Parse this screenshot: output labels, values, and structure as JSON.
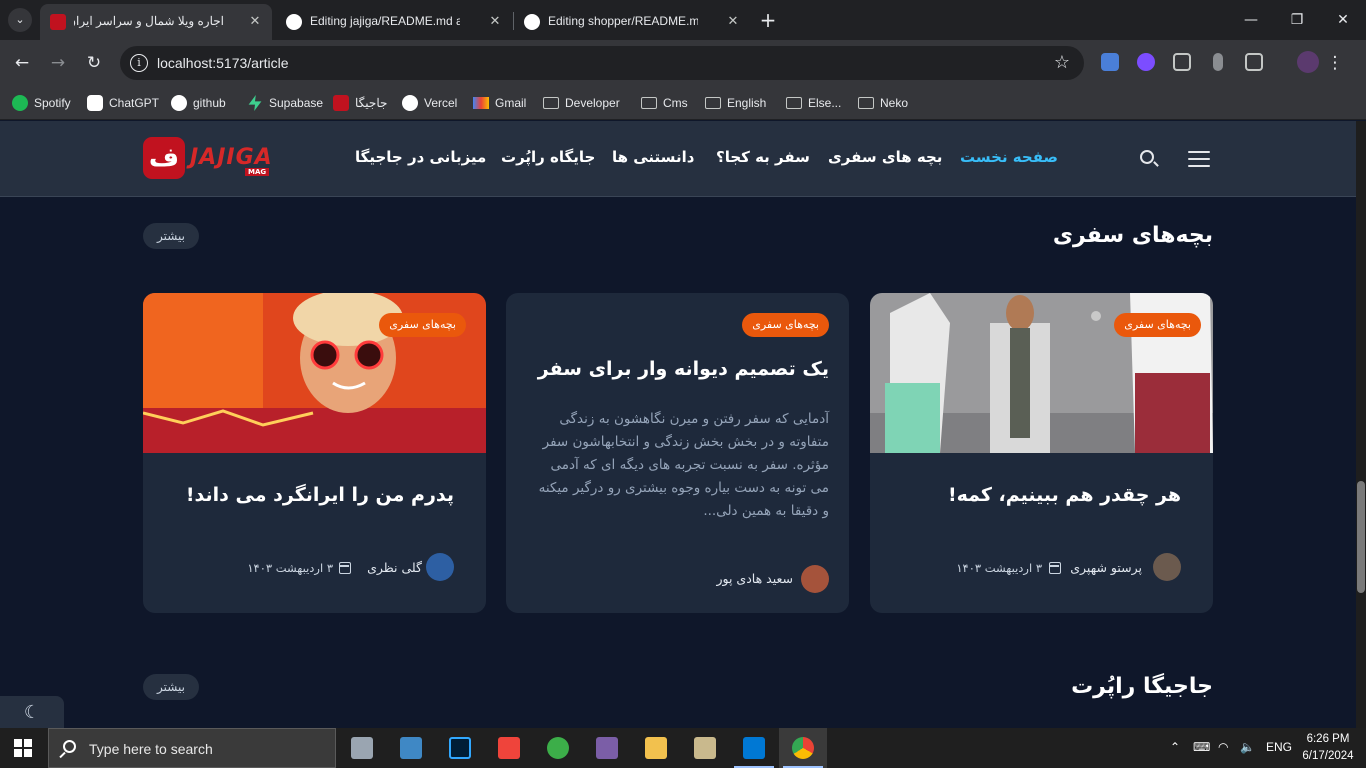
{
  "browser": {
    "tabs": [
      {
        "title": "اجاره ویلا شمال و سراسر ایران زیبا",
        "active": true
      },
      {
        "title": "Editing jajiga/README.md at m",
        "active": false
      },
      {
        "title": "Editing shopper/README.md at",
        "active": false
      }
    ],
    "url": "localhost:5173/article",
    "bookmarks": [
      "Spotify",
      "ChatGPT",
      "github",
      "Supabase",
      "جاجیگا",
      "Vercel",
      "Gmail",
      "Developer",
      "Cms",
      "English",
      "Else...",
      "Neko"
    ]
  },
  "site": {
    "logo_text": "JAJIGA",
    "logo_sub": "MAG",
    "nav": [
      "صفحه نخست",
      "بچه های سفری",
      "سفر به کجا؟",
      "دانستنی ها",
      "جایگاه راپُرت",
      "میزبانی در جاجیگا"
    ],
    "active_nav": "صفحه نخست"
  },
  "sections": [
    {
      "title": "بچه‌های سفری",
      "more": "بیشتر"
    },
    {
      "title": "جاجیگا راپُرت",
      "more": "بیشتر"
    }
  ],
  "cards": [
    {
      "category": "بچه‌های سفری",
      "title": "هر چقدر هم ببینیم، کمه!",
      "author": "پرستو شهپری",
      "date": "۳ اردیبهشت ۱۴۰۳"
    },
    {
      "category": "بچه‌های سفری",
      "title": "یک تصمیم دیوانه وار برای سفر",
      "excerpt": "آدمایی که سفر رفتن و میرن نگاهشون به زندگی متفاوته و در بخش بخش زندگی و انتخابهاشون سفر مؤثره. سفر به نسبت تجربه های دیگه ای که آدمی می تونه به دست بیاره وجوه بیشتری رو درگیر میکنه و دقیقا به همین دلی...",
      "author": "سعید هادی پور"
    },
    {
      "category": "بچه‌های سفری",
      "title": "پدرم من را ایرانگرد می داند!",
      "author": "گلی نظری",
      "date": "۳ اردیبهشت ۱۴۰۳"
    }
  ],
  "taskbar": {
    "search_placeholder": "Type here to search",
    "lang": "ENG",
    "time": "6:26 PM",
    "date": "6/17/2024"
  },
  "colors": {
    "accent": "#38bdf8",
    "badge": "#ea580c",
    "bg": "#0f172a",
    "card": "#1e293b",
    "brand": "#c1121f"
  }
}
